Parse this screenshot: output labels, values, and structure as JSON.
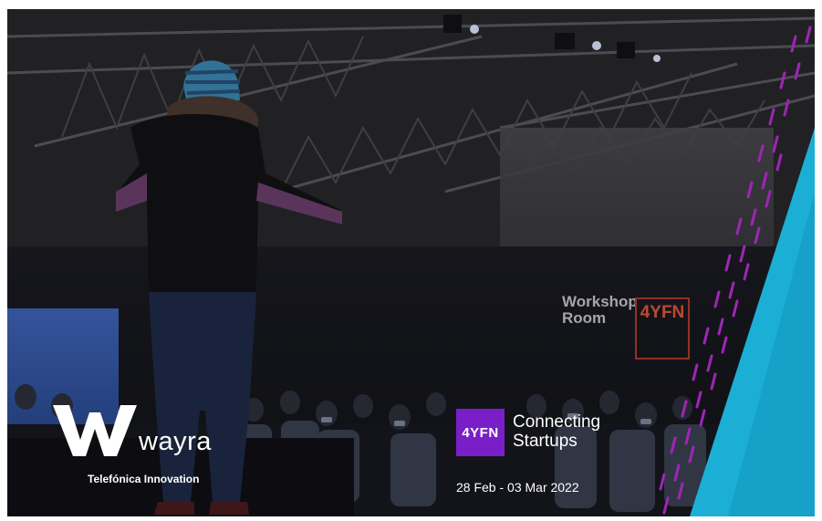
{
  "photo": {
    "workshop_sign_line1": "Workshop",
    "workshop_sign_line2": "Room",
    "venue_sign": "4YFN"
  },
  "wayra_logo": {
    "wordmark": "wayra",
    "tagline": "Telefónica Innovation"
  },
  "event": {
    "badge": "4YFN",
    "title_line1": "Connecting",
    "title_line2": "Startups",
    "dates": "28 Feb  -  03 Mar 2022"
  },
  "colors": {
    "brand_purple": "#7a1fc7",
    "accent_cyan": "#1fd3ff",
    "stripe_magenta": "#c02bd9"
  }
}
